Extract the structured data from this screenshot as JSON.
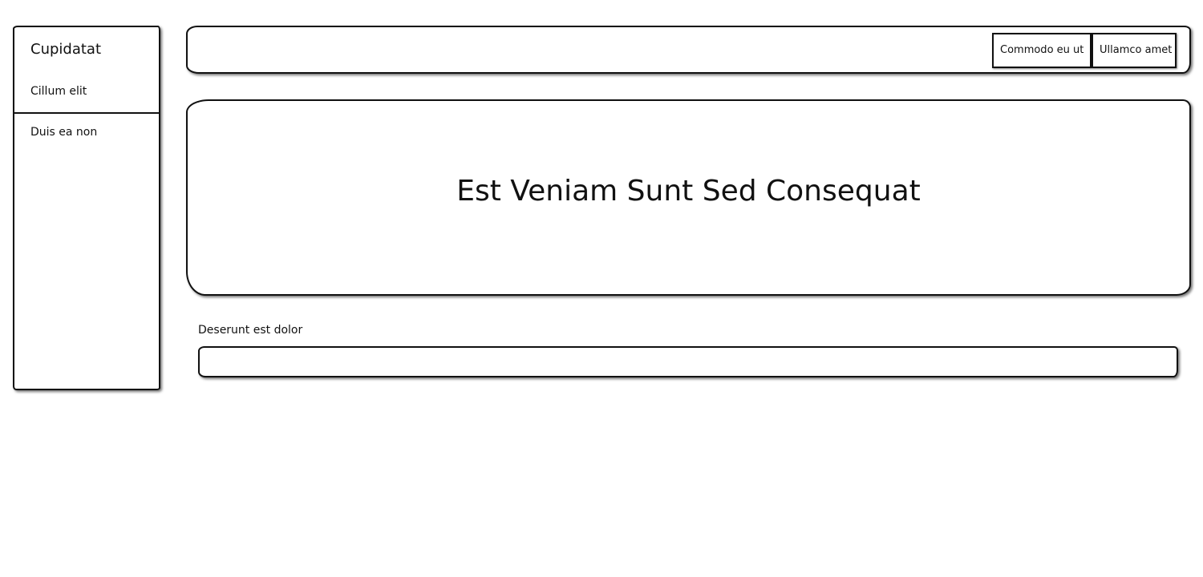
{
  "sidebar": {
    "title": "Cupidatat",
    "items": [
      {
        "label": "Cillum elit"
      },
      {
        "label": "Duis ea non"
      }
    ]
  },
  "header": {
    "buttons": [
      {
        "label": "Commodo eu ut"
      },
      {
        "label": "Ullamco amet"
      }
    ]
  },
  "hero": {
    "title": "Est Veniam Sunt Sed Consequat"
  },
  "form": {
    "field_label": "Deserunt est dolor",
    "field_value": ""
  }
}
